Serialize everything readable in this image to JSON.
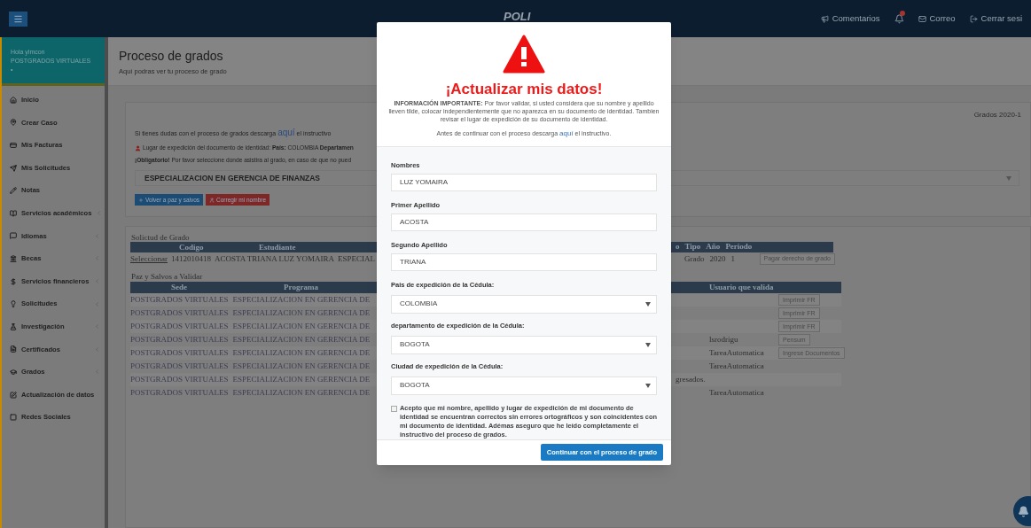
{
  "topbar": {
    "logo": "POLI",
    "links": [
      {
        "label": "Comentarios"
      },
      {
        "label": "Correo"
      },
      {
        "label": "Cerrar sesi"
      }
    ],
    "notification_badge": true
  },
  "sidebar": {
    "greeting": "Hola ylmcon",
    "campus": "POSTGRADOS VIRTUALES",
    "status_dot": "•",
    "items": [
      {
        "label": "Inicio",
        "has_submenu": false
      },
      {
        "label": "Crear Caso",
        "has_submenu": false
      },
      {
        "label": "Mis Facturas",
        "has_submenu": false
      },
      {
        "label": "Mis Solicitudes",
        "has_submenu": false
      },
      {
        "label": "Notas",
        "has_submenu": false
      },
      {
        "label": "Servicios académicos",
        "has_submenu": true
      },
      {
        "label": "Idiomas",
        "has_submenu": true
      },
      {
        "label": "Becas",
        "has_submenu": true
      },
      {
        "label": "Servicios financieros",
        "has_submenu": true
      },
      {
        "label": "Solicitudes",
        "has_submenu": true
      },
      {
        "label": "Investigación",
        "has_submenu": true
      },
      {
        "label": "Certificados",
        "has_submenu": true
      },
      {
        "label": "Grados",
        "has_submenu": true
      },
      {
        "label": "Actualización de datos",
        "has_submenu": false
      },
      {
        "label": "Redes Sociales",
        "has_submenu": false
      }
    ]
  },
  "page": {
    "title": "Proceso de grados",
    "subtitle": "Aquí podras ver tu proceso de grado"
  },
  "info_card": {
    "period": "Grados  2020-1",
    "help": {
      "before": "Si tienes dudas con el proceso de grados descarga",
      "link": "aquí",
      "after": "el instructivo"
    },
    "place_line": "Lugar de expedición del documento de identidad: **País:** COLOMBIA **Departamen**",
    "mandatory_line": "**¡Obligatorio!** Por favor seleccione donde asistira al grado, en caso de que no pued",
    "program_select": "ESPECIALIZACION EN GERENCIA DE FINANZAS",
    "buttons": [
      {
        "label": "Volver a paz y salvos",
        "kind": "primary"
      },
      {
        "label": "Corregir mi nombre",
        "kind": "danger"
      }
    ]
  },
  "request_table": {
    "title": "Solictud de Grado",
    "left_columns": [
      "Codigo",
      "Estudiante"
    ],
    "right_columns": [
      "o",
      "Tipo",
      "Año",
      "Periodo"
    ],
    "rows": [
      {
        "select_link": "Seleccionar",
        "code": "1412010418",
        "student": "ACOSTA TRIANA LUZ YOMAIRA",
        "program": "ESPECIAL",
        "type": "Grado",
        "year": "2020",
        "period": "1",
        "action": "Pagar derecho de grado"
      }
    ]
  },
  "clearance_table": {
    "title": "Paz y Salvos a Validar",
    "left_columns": [
      "Sede",
      "Programa"
    ],
    "right_columns": [
      "Usuario que valida"
    ],
    "rows": [
      {
        "campus": "POSTGRADOS VIRTUALES",
        "program": "ESPECIALIZACION EN GERENCIA DE",
        "action": "Imprimir FR"
      },
      {
        "campus": "POSTGRADOS VIRTUALES",
        "program": "ESPECIALIZACION EN GERENCIA DE",
        "action": "Imprimir FR"
      },
      {
        "campus": "POSTGRADOS VIRTUALES",
        "program": "ESPECIALIZACION EN GERENCIA DE",
        "action": "Imprimir FR"
      },
      {
        "campus": "POSTGRADOS VIRTUALES",
        "program": "ESPECIALIZACION EN GERENCIA DE",
        "user": "lsrodrigu",
        "action": "Pensum"
      },
      {
        "campus": "POSTGRADOS VIRTUALES",
        "program": "ESPECIALIZACION EN GERENCIA DE",
        "user": "TareaAutomatica",
        "action": "Ingrese Documentos"
      },
      {
        "campus": "POSTGRADOS VIRTUALES",
        "program": "ESPECIALIZACION EN GERENCIA DE",
        "user": "TareaAutomatica"
      },
      {
        "campus": "POSTGRADOS VIRTUALES",
        "program": "ESPECIALIZACION EN GERENCIA DE",
        "note": "gresados."
      },
      {
        "campus": "POSTGRADOS VIRTUALES",
        "program": "ESPECIALIZACION EN GERENCIA DE",
        "user": "TareaAutomatica"
      }
    ]
  },
  "modal": {
    "title": "¡Actualizar mis datos!",
    "notice": "**INFORMACIÓN IMPORTANTE:** Por favor validar, si usted considera que su nombre y apellido lleven tilde, colocar independientemente que no aparezca en su documento de identidad. Tambien revisar el lugar de expedición de su documento de identidad.",
    "download": {
      "before": "Antes de continuar con el proceso descarga",
      "link": "aquí",
      "after": "el instructivo."
    },
    "fields": [
      {
        "label": "Nombres",
        "kind": "text",
        "value": "LUZ YOMAIRA"
      },
      {
        "label": "Primer Apellido",
        "kind": "text",
        "value": "ACOSTA"
      },
      {
        "label": "Segundo Apellido",
        "kind": "text",
        "value": "TRIANA"
      },
      {
        "label": "Pais de expedición de la Cédula:",
        "kind": "select",
        "value": "COLOMBIA"
      },
      {
        "label": "departamento de expedición de la Cédula:",
        "kind": "select",
        "value": "BOGOTA"
      },
      {
        "label": "Ciudad de expedición de la Cédula:",
        "kind": "select",
        "value": "BOGOTA"
      }
    ],
    "consent": {
      "checked": false,
      "text": "Acepto que mi nombre, apellido y lugar de expedición de mi documento de identidad se encuentran correctos sin errores ortográficos y son coincidentes con mi documento de identidad. Adémas aseguro que he leído completamente el instructivo del proceso de grados."
    },
    "submit": "Continuar con el proceso de grado"
  }
}
